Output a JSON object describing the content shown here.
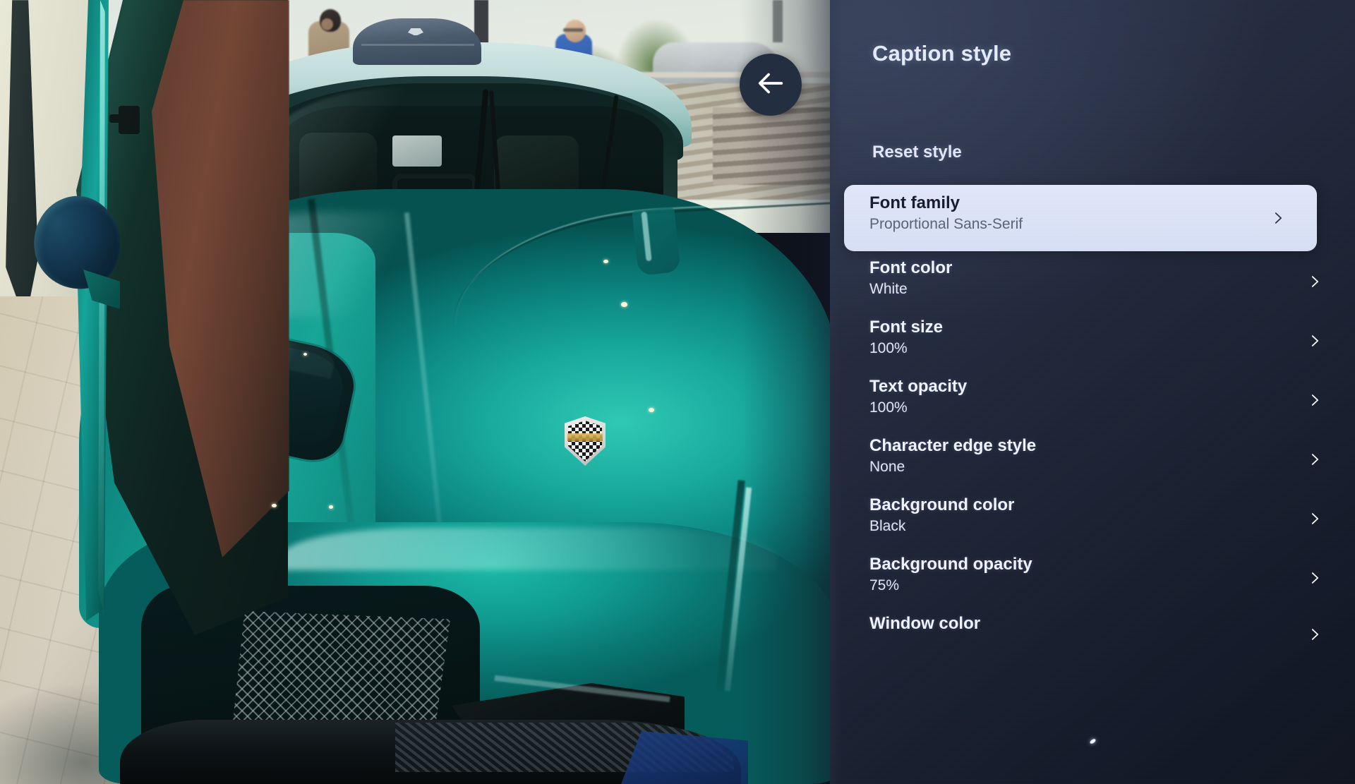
{
  "panel": {
    "title": "Caption style",
    "reset_label": "Reset style",
    "focused_index": 0,
    "accent_focus_bg": "#dde3f5",
    "accent_focus_text": "#161c2c",
    "panel_bg_top": "#2b3449",
    "panel_bg_bottom": "#101521",
    "rows": [
      {
        "title": "Font family",
        "value": "Proportional Sans-Serif",
        "chevron": "chevron-right-icon",
        "focused": true
      },
      {
        "title": "Font color",
        "value": "White",
        "chevron": "chevron-right-icon",
        "focused": false
      },
      {
        "title": "Font size",
        "value": "100%",
        "chevron": "chevron-right-icon",
        "focused": false
      },
      {
        "title": "Text opacity",
        "value": "100%",
        "chevron": "chevron-right-icon",
        "focused": false
      },
      {
        "title": "Character edge style",
        "value": "None",
        "chevron": "chevron-right-icon",
        "focused": false
      },
      {
        "title": "Background color",
        "value": "Black",
        "chevron": "chevron-right-icon",
        "focused": false
      },
      {
        "title": "Background opacity",
        "value": "75%",
        "chevron": "chevron-right-icon",
        "focused": false
      },
      {
        "title": "Window color",
        "value": "",
        "chevron": "chevron-right-icon",
        "focused": false
      }
    ]
  },
  "back_button": {
    "icon": "arrow-left-icon",
    "bg": "#242e41",
    "icon_color": "#ffffff"
  },
  "background_video": {
    "description": "Teal-green Koenigsegg supercar front view with open door at an outdoor car show",
    "car_color": "#14a89b",
    "sky_color": "#e7ece3",
    "floor_color": "#ddd7c6"
  }
}
